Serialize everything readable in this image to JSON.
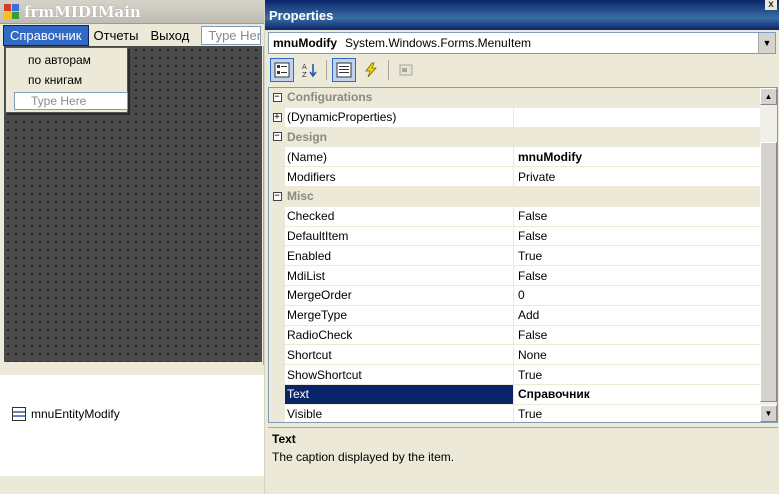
{
  "form": {
    "title": "frmMIDIMain",
    "menu": [
      {
        "label": "Справочник",
        "active": true
      },
      {
        "label": "Отчеты",
        "active": false
      },
      {
        "label": "Выход",
        "active": false
      }
    ],
    "menu_typehere": "Type Here",
    "dropdown": {
      "items": [
        "по авторам",
        "по книгам"
      ],
      "typehere": "Type Here"
    },
    "tray": {
      "item": "mnuEntityModify"
    }
  },
  "properties": {
    "title": "Properties",
    "close_glyph": "x",
    "object_name": "mnuModify",
    "object_type": "System.Windows.Forms.MenuItem",
    "rows": [
      {
        "kind": "category",
        "name": "Configurations",
        "expander": "−"
      },
      {
        "kind": "prop",
        "name": "(DynamicProperties)",
        "value": "",
        "expander": "+"
      },
      {
        "kind": "category",
        "name": "Design",
        "expander": "−"
      },
      {
        "kind": "prop",
        "name": "(Name)",
        "value": "mnuModify",
        "bold": true
      },
      {
        "kind": "prop",
        "name": "Modifiers",
        "value": "Private"
      },
      {
        "kind": "category",
        "name": "Misc",
        "expander": "−"
      },
      {
        "kind": "prop",
        "name": "Checked",
        "value": "False"
      },
      {
        "kind": "prop",
        "name": "DefaultItem",
        "value": "False"
      },
      {
        "kind": "prop",
        "name": "Enabled",
        "value": "True"
      },
      {
        "kind": "prop",
        "name": "MdiList",
        "value": "False"
      },
      {
        "kind": "prop",
        "name": "MergeOrder",
        "value": "0"
      },
      {
        "kind": "prop",
        "name": "MergeType",
        "value": "Add"
      },
      {
        "kind": "prop",
        "name": "RadioCheck",
        "value": "False"
      },
      {
        "kind": "prop",
        "name": "Shortcut",
        "value": "None"
      },
      {
        "kind": "prop",
        "name": "ShowShortcut",
        "value": "True"
      },
      {
        "kind": "prop",
        "name": "Text",
        "value": "Справочник",
        "bold": true,
        "selected": true
      },
      {
        "kind": "prop",
        "name": "Visible",
        "value": "True"
      }
    ],
    "description": {
      "title": "Text",
      "text": "The caption displayed by the item."
    }
  }
}
